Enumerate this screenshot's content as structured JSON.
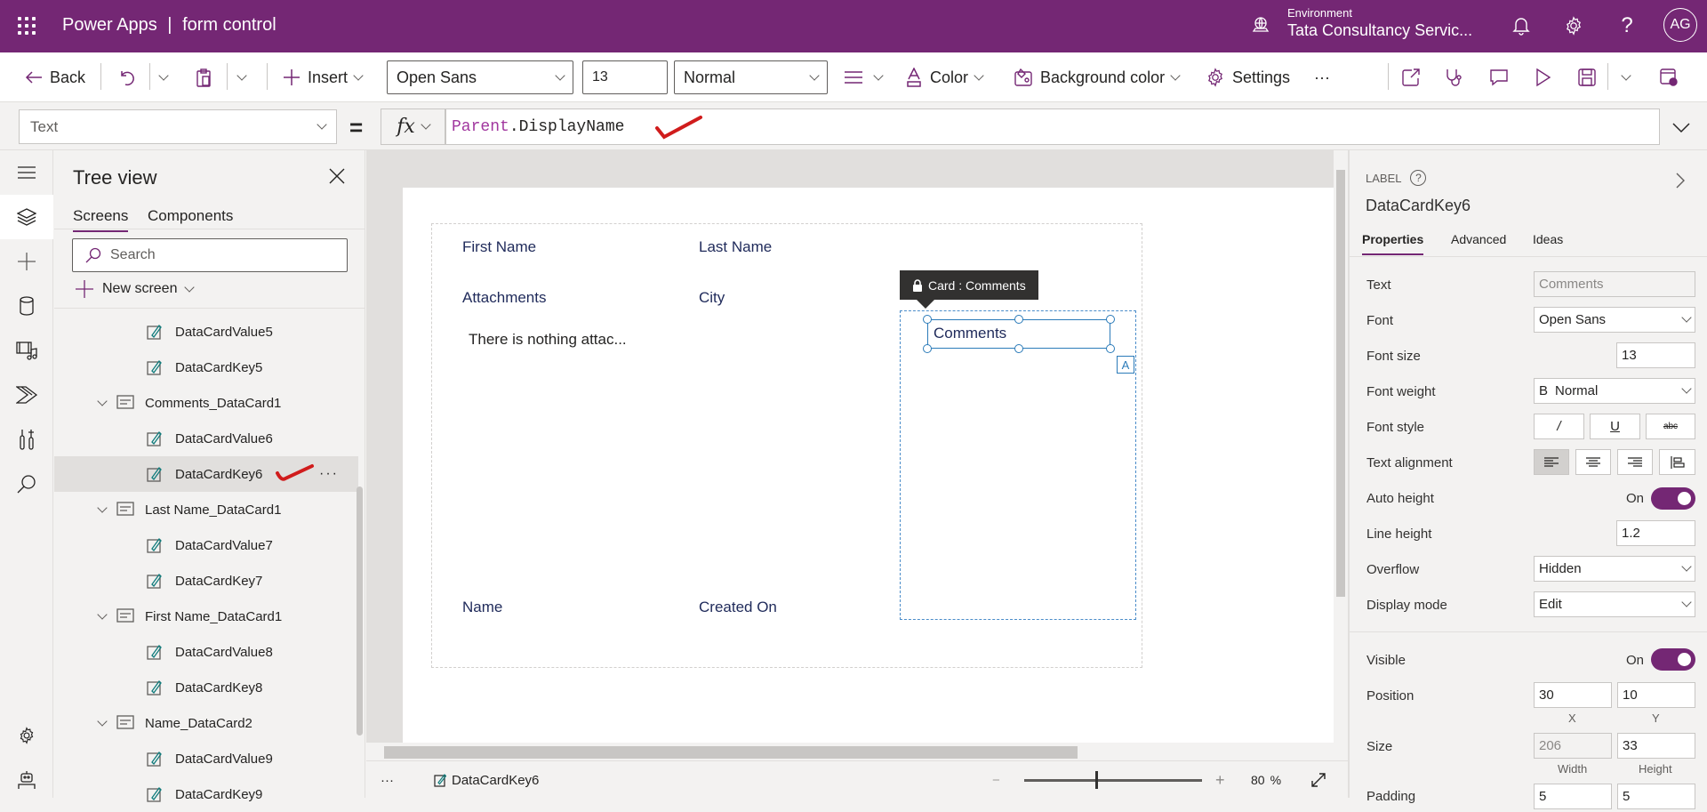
{
  "header": {
    "app_name": "Power Apps",
    "separator": "|",
    "app_title": "form control",
    "environment_label": "Environment",
    "environment_name": "Tata Consultancy Servic...",
    "user_initials": "AG",
    "brand_color": "#742774"
  },
  "toolbar": {
    "back_label": "Back",
    "insert_label": "Insert",
    "font_family": "Open Sans",
    "font_size": "13",
    "font_weight": "Normal",
    "color_label": "Color",
    "background_color_label": "Background color",
    "settings_label": "Settings",
    "more_label": "···"
  },
  "formula_bar": {
    "property": "Text",
    "equals": "=",
    "fx_label": "fx",
    "formula_keyword": "Parent",
    "formula_rest": ".DisplayName"
  },
  "tree_view": {
    "title": "Tree view",
    "tabs": [
      {
        "label": "Screens",
        "active": true
      },
      {
        "label": "Components",
        "active": false
      }
    ],
    "search_placeholder": "Search",
    "new_screen_label": "New screen",
    "more_options": "···",
    "items": [
      {
        "label": "DataCardValue5",
        "type": "control",
        "level": 2
      },
      {
        "label": "DataCardKey5",
        "type": "control",
        "level": 2
      },
      {
        "label": "Comments_DataCard1",
        "type": "card",
        "level": 1
      },
      {
        "label": "DataCardValue6",
        "type": "control",
        "level": 2
      },
      {
        "label": "DataCardKey6",
        "type": "control",
        "level": 2,
        "selected": true
      },
      {
        "label": "Last Name_DataCard1",
        "type": "card",
        "level": 1
      },
      {
        "label": "DataCardValue7",
        "type": "control",
        "level": 2
      },
      {
        "label": "DataCardKey7",
        "type": "control",
        "level": 2
      },
      {
        "label": "First Name_DataCard1",
        "type": "card",
        "level": 1
      },
      {
        "label": "DataCardValue8",
        "type": "control",
        "level": 2
      },
      {
        "label": "DataCardKey8",
        "type": "control",
        "level": 2
      },
      {
        "label": "Name_DataCard2",
        "type": "card",
        "level": 1
      },
      {
        "label": "DataCardValue9",
        "type": "control",
        "level": 2
      },
      {
        "label": "DataCardKey9",
        "type": "control",
        "level": 2
      }
    ]
  },
  "canvas": {
    "fields": {
      "first_name": "First Name",
      "last_name": "Last Name",
      "attachments": "Attachments",
      "city": "City",
      "attachments_empty": "There is nothing attac...",
      "name": "Name",
      "created_on": "Created On"
    },
    "tooltip": "Card : Comments",
    "selected_label_text": "Comments",
    "badge": "A"
  },
  "status_bar": {
    "more": "···",
    "selected_control": "DataCardKey6",
    "zoom_value": "80",
    "zoom_unit": "%",
    "zoom_fraction": 0.4
  },
  "properties": {
    "kind": "LABEL",
    "help": "?",
    "control_name": "DataCardKey6",
    "tabs": [
      {
        "label": "Properties",
        "active": true
      },
      {
        "label": "Advanced",
        "active": false
      },
      {
        "label": "Ideas",
        "active": false
      }
    ],
    "text_label": "Text",
    "text_value": "Comments",
    "font_label": "Font",
    "font_value": "Open Sans",
    "font_size_label": "Font size",
    "font_size_value": "13",
    "font_weight_label": "Font weight",
    "font_weight_glyph": "B",
    "font_weight_value": "Normal",
    "font_style_label": "Font style",
    "font_style_options": [
      "/",
      "U",
      "abc"
    ],
    "text_alignment_label": "Text alignment",
    "auto_height_label": "Auto height",
    "auto_height_value": "On",
    "line_height_label": "Line height",
    "line_height_value": "1.2",
    "overflow_label": "Overflow",
    "overflow_value": "Hidden",
    "display_mode_label": "Display mode",
    "display_mode_value": "Edit",
    "visible_label": "Visible",
    "visible_value": "On",
    "position_label": "Position",
    "position_x": "30",
    "position_y": "10",
    "x_label": "X",
    "y_label": "Y",
    "size_label": "Size",
    "size_width": "206",
    "size_height": "33",
    "width_label": "Width",
    "height_label": "Height",
    "padding_label": "Padding",
    "padding_a": "5",
    "padding_b": "5"
  }
}
